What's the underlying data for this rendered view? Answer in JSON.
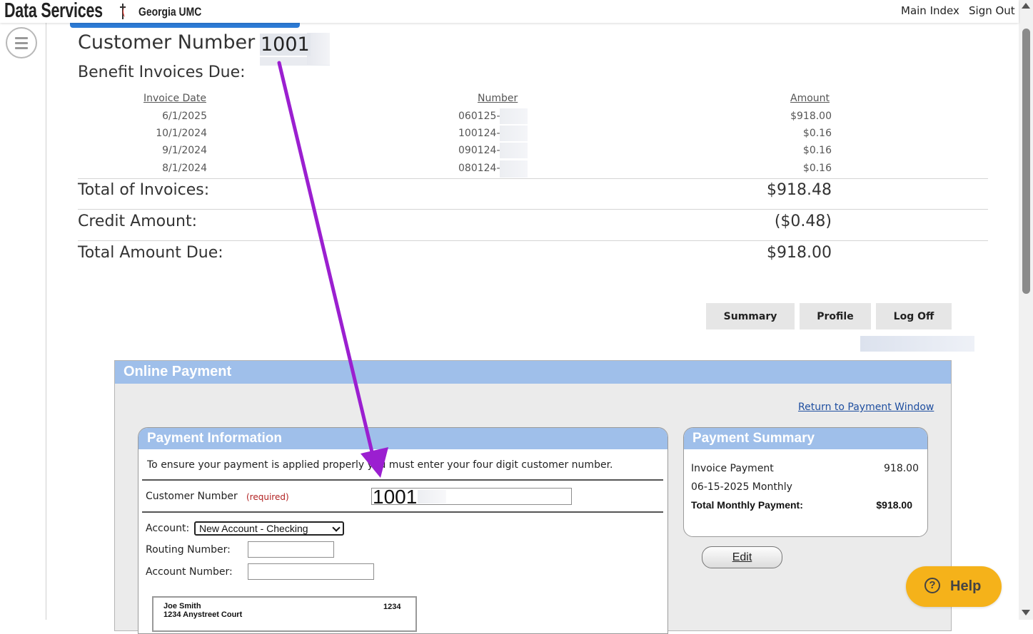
{
  "header": {
    "brand": "Data Services",
    "org": "Georgia UMC",
    "main_index": "Main Index",
    "sign_out": "Sign Out"
  },
  "customer": {
    "label": "Customer Number",
    "number": "1001"
  },
  "invoices": {
    "title": "Benefit Invoices Due:",
    "columns": [
      "Invoice Date",
      "Number",
      "Amount"
    ],
    "rows": [
      {
        "date": "6/1/2025",
        "number": "060125-",
        "amount": "$918.00"
      },
      {
        "date": "10/1/2024",
        "number": "100124-",
        "amount": "$0.16"
      },
      {
        "date": "9/1/2024",
        "number": "090124-",
        "amount": "$0.16"
      },
      {
        "date": "8/1/2024",
        "number": "080124-",
        "amount": "$0.16"
      }
    ]
  },
  "totals": {
    "invoices_label": "Total of Invoices:",
    "invoices_value": "$918.48",
    "credit_label": "Credit Amount:",
    "credit_value": "($0.48)",
    "due_label": "Total Amount Due:",
    "due_value": "$918.00"
  },
  "actions": {
    "summary": "Summary",
    "profile": "Profile",
    "log_off": "Log Off"
  },
  "online_payment": {
    "title": "Online Payment",
    "return_link": "Return to Payment Window",
    "payment_information": {
      "title": "Payment Information",
      "notice": "To ensure your payment is applied properly you must enter your four digit customer number.",
      "customer_number_label": "Customer Number",
      "required": "(required)",
      "customer_number_value": "1001",
      "account_label": "Account:",
      "account_selected": "New Account - Checking",
      "routing_label": "Routing Number:",
      "account_number_label": "Account Number:",
      "check_name": "Joe Smith",
      "check_address": "1234 Anystreet Court",
      "check_number": "1234"
    },
    "payment_summary": {
      "title": "Payment Summary",
      "line1_label": "Invoice Payment",
      "line1_value": "918.00",
      "line2_label": "06-15-2025 Monthly",
      "total_label": "Total Monthly Payment:",
      "total_value": "$918.00"
    },
    "edit": "Edit"
  },
  "help": {
    "label": "Help",
    "icon": "question-mark-icon"
  },
  "colors": {
    "panel_header": "#9fbfea",
    "accent_bar": "#2c7bd6",
    "annotation_arrow": "#9b1fd0",
    "help_button": "#f5b21a"
  }
}
